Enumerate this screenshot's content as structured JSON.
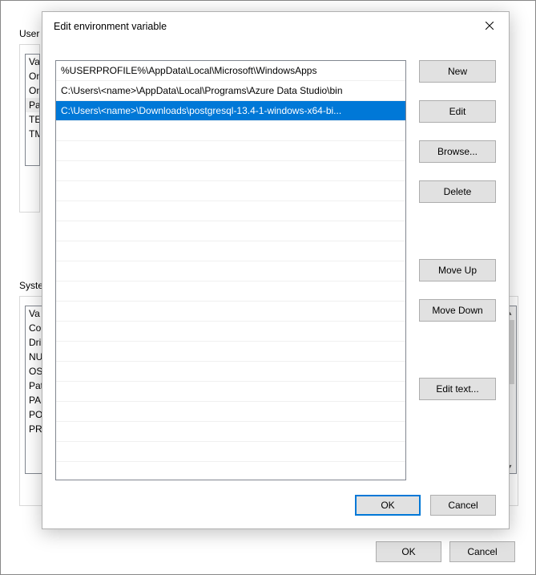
{
  "background": {
    "userSectionLabel": "User",
    "systemSectionLabel": "Syste",
    "userVars": [
      "Va",
      "On",
      "On",
      "Pat",
      "TE",
      "TM"
    ],
    "systemVars": [
      "Va",
      "Co",
      "Dri",
      "NU",
      "OS",
      "Pat",
      "PA",
      "PO",
      "PR"
    ],
    "buttons": {
      "ok": "OK",
      "cancel": "Cancel"
    }
  },
  "dialog": {
    "title": "Edit environment variable",
    "paths": [
      {
        "text": "%USERPROFILE%\\AppData\\Local\\Microsoft\\WindowsApps",
        "selected": false
      },
      {
        "text": "C:\\Users\\<name>\\AppData\\Local\\Programs\\Azure Data Studio\\bin",
        "selected": false
      },
      {
        "text": "C:\\Users\\<name>\\Downloads\\postgresql-13.4-1-windows-x64-bi...",
        "selected": true
      }
    ],
    "sideButtons": {
      "new": "New",
      "edit": "Edit",
      "browse": "Browse...",
      "delete": "Delete",
      "moveUp": "Move Up",
      "moveDown": "Move Down",
      "editText": "Edit text..."
    },
    "ok": "OK",
    "cancel": "Cancel"
  }
}
